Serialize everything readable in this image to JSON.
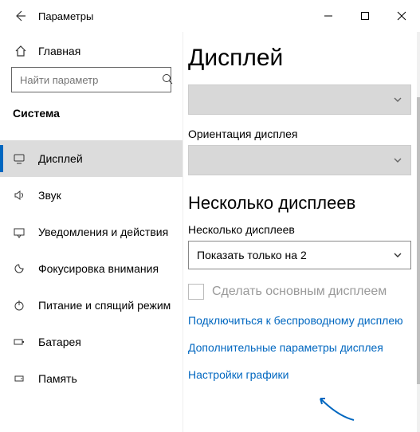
{
  "window": {
    "title": "Параметры"
  },
  "home": {
    "label": "Главная"
  },
  "search": {
    "placeholder": "Найти параметр"
  },
  "section": {
    "title": "Система"
  },
  "nav": [
    {
      "icon": "display",
      "label": "Дисплей",
      "active": true
    },
    {
      "icon": "sound",
      "label": "Звук",
      "active": false
    },
    {
      "icon": "notify",
      "label": "Уведомления и действия",
      "active": false
    },
    {
      "icon": "focus",
      "label": "Фокусировка внимания",
      "active": false
    },
    {
      "icon": "power",
      "label": "Питание и спящий режим",
      "active": false
    },
    {
      "icon": "battery",
      "label": "Батарея",
      "active": false
    },
    {
      "icon": "storage",
      "label": "Память",
      "active": false
    }
  ],
  "page": {
    "heading": "Дисплей",
    "orientation_label": "Ориентация дисплея",
    "multi_heading": "Несколько дисплеев",
    "multi_label": "Несколько дисплеев",
    "multi_value": "Показать только на 2",
    "main_display_checkbox": "Сделать основным дисплеем",
    "links": {
      "wireless": "Подключиться к беспроводному дисплею",
      "advanced": "Дополнительные параметры дисплея",
      "graphics": "Настройки графики"
    }
  }
}
